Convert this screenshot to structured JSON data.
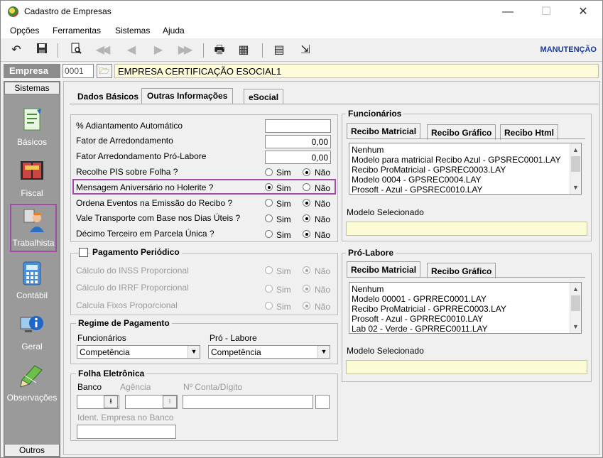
{
  "window": {
    "title": "Cadastro de Empresas",
    "minimize": "—",
    "maximize": "☐",
    "close": "✕"
  },
  "menu": [
    "Opções",
    "Ferramentas",
    "Sistemas",
    "Ajuda"
  ],
  "toolbar": {
    "mode": "MANUTENÇÃO"
  },
  "empresa": {
    "label": "Empresa",
    "code": "0001",
    "name": "EMPRESA CERTIFICAÇÃO ESOCIAL1"
  },
  "sidebar": {
    "top": "Sistemas",
    "bottom": "Outros",
    "items": [
      {
        "label": "Básicos",
        "icon": "document-icon"
      },
      {
        "label": "Fiscal",
        "icon": "book-icon"
      },
      {
        "label": "Trabalhista",
        "icon": "worker-icon"
      },
      {
        "label": "Contábil",
        "icon": "calculator-icon"
      },
      {
        "label": "Geral",
        "icon": "info-icon"
      },
      {
        "label": "Observações",
        "icon": "pencil-icon"
      }
    ]
  },
  "tabs": [
    "Dados Básicos",
    "Outras Informações",
    "eSocial"
  ],
  "fields": {
    "adiantamento": {
      "label": "% Adiantamento Automático",
      "value": ""
    },
    "fator": {
      "label": "Fator de Arredondamento",
      "value": "0,00"
    },
    "fator_pro": {
      "label": "Fator Arredondamento Pró-Labore",
      "value": "0,00"
    }
  },
  "radios": {
    "sim": "Sim",
    "nao": "Não",
    "rows": [
      {
        "label": "Recolhe PIS sobre Folha ?",
        "selected": "nao"
      },
      {
        "label": "Mensagem Aniversário no Holerite ?",
        "selected": "sim"
      },
      {
        "label": "Ordena Eventos na Emissão do Recibo ?",
        "selected": "nao"
      },
      {
        "label": "Vale Transporte com Base nos Dias Úteis ?",
        "selected": "nao"
      },
      {
        "label": "Décimo Terceiro em Parcela Única ?",
        "selected": "nao"
      }
    ]
  },
  "pagamento_periodico": {
    "title": "Pagamento Periódico",
    "checked": false,
    "rows": [
      {
        "label": "Cálculo do INSS Proporcional",
        "selected": "nao"
      },
      {
        "label": "Cálculo do IRRF Proporcional",
        "selected": "nao"
      },
      {
        "label": "Calcula Fixos Proporcional",
        "selected": "nao"
      }
    ]
  },
  "regime": {
    "title": "Regime de Pagamento",
    "func_label": "Funcionários",
    "func_value": "Competência",
    "pro_label": "Pró - Labore",
    "pro_value": "Competência"
  },
  "folha": {
    "title": "Folha Eletrônica",
    "banco": "Banco",
    "agencia": "Agência",
    "conta": "Nº Conta/Dígito",
    "ident": "Ident. Empresa no Banco"
  },
  "funcionarios": {
    "title": "Funcionários",
    "tabs": [
      "Recibo Matricial",
      "Recibo Gráfico",
      "Recibo Html"
    ],
    "items": [
      "Nenhum",
      "Modelo para matricial Recibo Azul - GPSREC0001.LAY",
      "Recibo ProMatricial - GPSREC0003.LAY",
      "Modelo 0004 - GPSREC0004.LAY",
      "Prosoft - Azul - GPSREC0010.LAY"
    ],
    "selected_label": "Modelo Selecionado",
    "selected_value": ""
  },
  "prolabore": {
    "title": "Pró-Labore",
    "tabs": [
      "Recibo Matricial",
      "Recibo Gráfico"
    ],
    "items": [
      "Nenhum",
      "Modelo 00001 - GPRREC0001.LAY",
      "Recibo ProMatricial - GPRREC0003.LAY",
      "Prosoft - Azul - GPRREC0010.LAY",
      "Lab 02 - Verde - GPRREC0011.LAY"
    ],
    "selected_label": "Modelo Selecionado",
    "selected_value": ""
  },
  "colors": {
    "accent": "#1a3b95",
    "highlight": "#a14aa6",
    "yellow": "#fcfcd4"
  }
}
